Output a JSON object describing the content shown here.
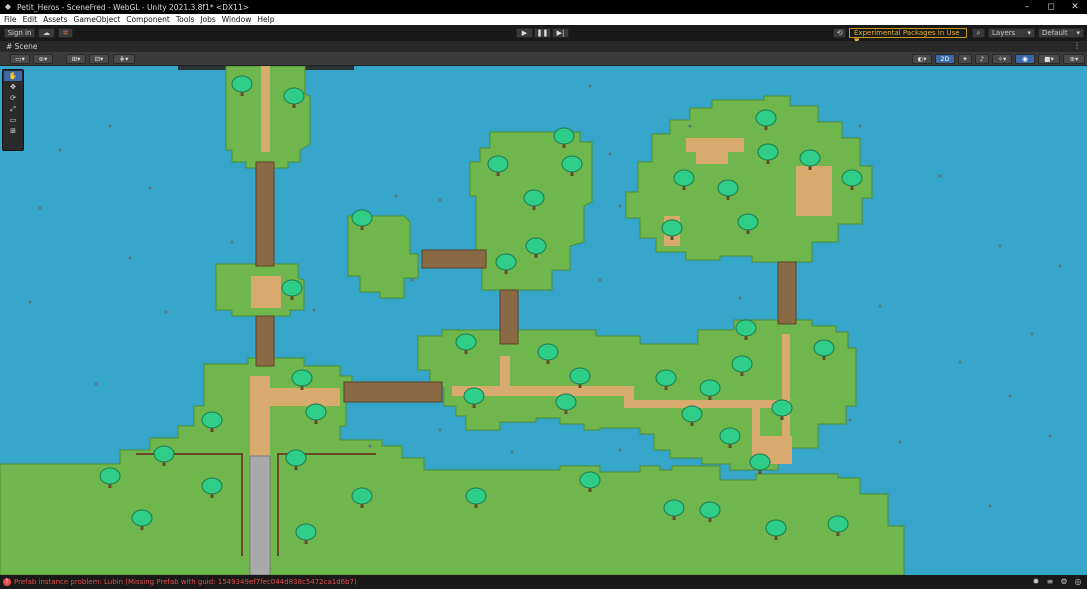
{
  "window": {
    "title": "Petit_Heros - SceneFred - WebGL - Unity 2021.3.8f1* <DX11>",
    "app_icon": "unity-icon",
    "controls": [
      "–",
      "◻",
      "✕"
    ]
  },
  "menu": {
    "items": [
      "File",
      "Edit",
      "Assets",
      "GameObject",
      "Component",
      "Tools",
      "Jobs",
      "Window",
      "Help"
    ]
  },
  "toolbar": {
    "sign_in_label": "Sign in",
    "cloud_icon": "☁",
    "collab_icon": "✲",
    "play_icon": "▶",
    "pause_icon": "❚❚",
    "step_icon": "▶|",
    "history_icon": "⟲",
    "experimental_label": "Experimental Packages In Use ▼",
    "search_icon": "⌕",
    "layers_label": "Layers",
    "layout_label": "Default"
  },
  "scene_tab": {
    "label": "# Scene",
    "menu": "⋮"
  },
  "scene_toolbar": {
    "mode_2d_label": "2D"
  },
  "tools": {
    "items": [
      {
        "name": "hand-tool",
        "glyph": "✋"
      },
      {
        "name": "move-tool",
        "glyph": "✥"
      },
      {
        "name": "rotate-tool",
        "glyph": "⟳"
      },
      {
        "name": "scale-tool",
        "glyph": "⤢"
      },
      {
        "name": "rect-tool",
        "glyph": "▭"
      },
      {
        "name": "transform-tool",
        "glyph": "⊞"
      }
    ]
  },
  "status": {
    "message": "Prefab instance problem: Lubin (Missing Prefab with guid: 1549349ef7fec044d838c5472ca1d6b7)"
  },
  "colors": {
    "water": "#35a6c9",
    "grass": "#6fb74c",
    "grass_dark": "#4d8f34",
    "path": "#d8aa6e",
    "bridge": "#8a6a44",
    "tree": "#2fce88",
    "accent_blue": "#3c6aa8",
    "warning": "#e7b32a",
    "error": "#e54d4d"
  }
}
